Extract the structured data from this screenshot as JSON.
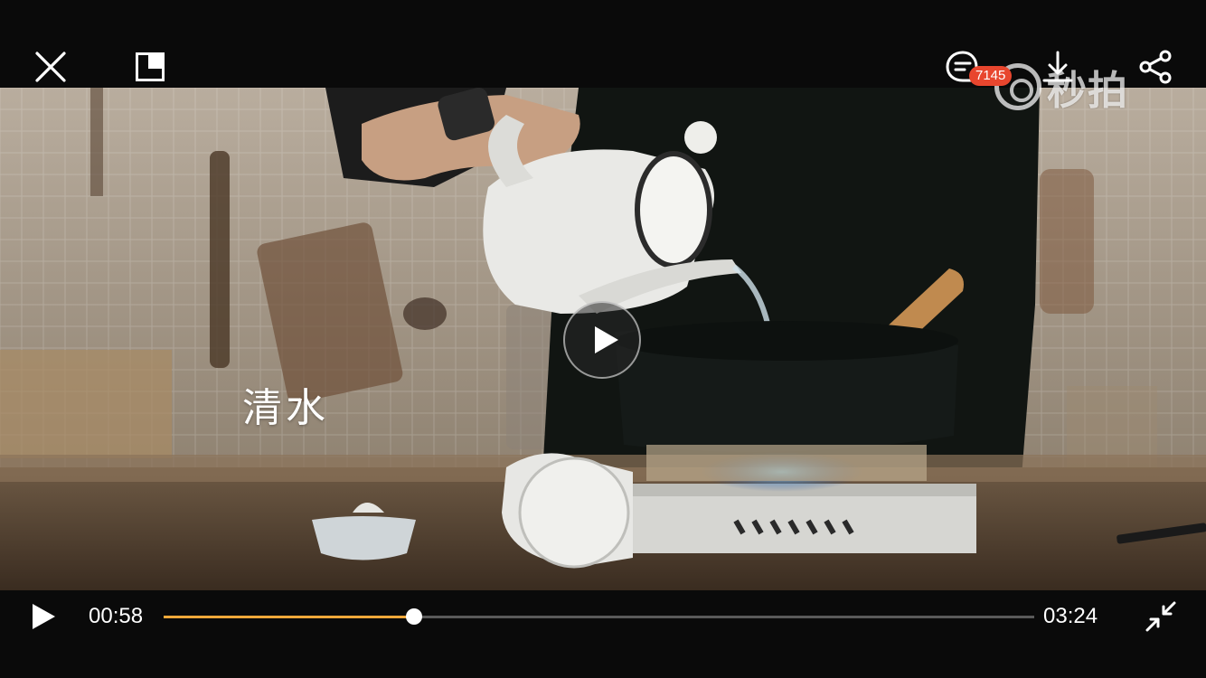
{
  "player": {
    "watermark": "秒拍",
    "subtitle": "清水",
    "comment_count": "7145",
    "current_time": "00:58",
    "duration": "03:24",
    "progress": 0.288
  },
  "colors": {
    "progress_fill": "#f0a83a",
    "badge": "#e8462e",
    "bar_background": "#0a0a0a"
  },
  "icons": {
    "close": "close-icon",
    "pip": "picture-in-picture-icon",
    "comment": "comment-icon",
    "download": "download-icon",
    "share": "share-icon",
    "play": "play-icon",
    "collapse": "exit-fullscreen-icon"
  }
}
